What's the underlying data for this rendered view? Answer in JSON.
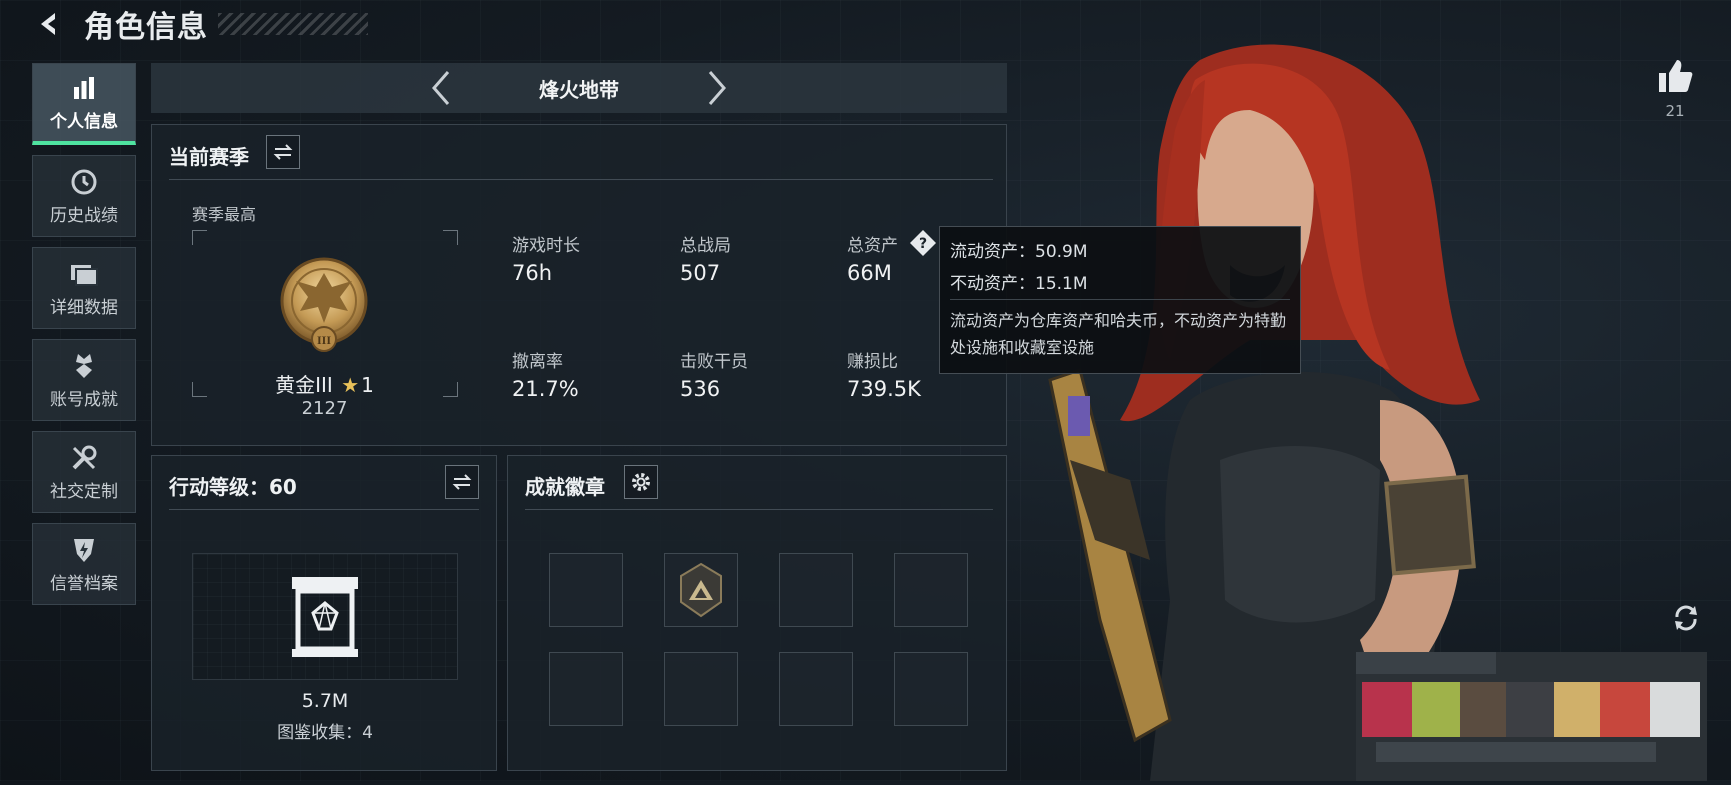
{
  "header": {
    "title": "角色信息",
    "back_icon": "back-arrow-icon"
  },
  "sidebar": {
    "items": [
      {
        "label": "个人信息",
        "icon": "bar-chart-icon",
        "active": true
      },
      {
        "label": "历史战绩",
        "icon": "clock-icon",
        "active": false
      },
      {
        "label": "详细数据",
        "icon": "folder-icon",
        "active": false
      },
      {
        "label": "账号成就",
        "icon": "medal-icon",
        "active": false
      },
      {
        "label": "社交定制",
        "icon": "wrench-icon",
        "active": false
      },
      {
        "label": "信誉档案",
        "icon": "shield-lightning-icon",
        "active": false
      }
    ]
  },
  "mode": {
    "title": "烽火地带"
  },
  "season": {
    "title": "当前赛季",
    "best_label": "赛季最高",
    "rank_name": "黄金III",
    "rank_stars": "1",
    "rank_score": "2127",
    "stats": [
      {
        "label": "游戏时长",
        "value": "76h"
      },
      {
        "label": "总战局",
        "value": "507"
      },
      {
        "label": "总资产",
        "value": "66M"
      },
      {
        "label": "撤离率",
        "value": "21.7%"
      },
      {
        "label": "击败干员",
        "value": "536"
      },
      {
        "label": "赚损比",
        "value": "739.5K"
      }
    ]
  },
  "tooltip": {
    "liquid": "流动资产：50.9M",
    "fixed": "不动资产：15.1M",
    "description": "流动资产为仓库资产和哈夫币，不动资产为特勤处设施和收藏室设施"
  },
  "action_level": {
    "title": "行动等级：60",
    "value": "5.7M",
    "collection": "图鉴收集：4"
  },
  "badges": {
    "title": "成就徽章"
  },
  "likes": {
    "count": "21"
  },
  "colors": {
    "accent": "#4fe3a0",
    "panel_bg": "#1a2229",
    "rank_gold": "#c9a45a"
  }
}
